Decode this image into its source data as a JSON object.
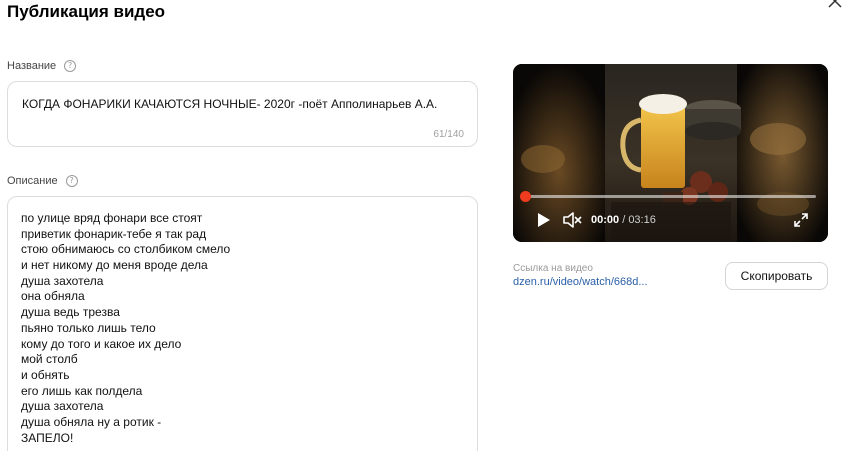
{
  "dialog": {
    "title": "Публикация видео",
    "close_icon": "close-icon"
  },
  "name_field": {
    "label": "Название",
    "help_icon": "question-icon",
    "value": "КОГДА ФОНАРИКИ КАЧАЮТСЯ НОЧНЫЕ- 2020г -поёт Апполинарьев А.А.",
    "counter": "61/140"
  },
  "description_field": {
    "label": "Описание",
    "help_icon": "question-icon",
    "lines": [
      "по улице вряд фонари все стоят",
      "приветик фонарик-тебе я так рад",
      "стою обнимаюсь со столбиком смело",
      "и нет никому до меня вроде дела",
      "душа захотела",
      "она обняла",
      "душа ведь трезва",
      "пьяно только лишь тело",
      "кому до того и какое их дело",
      "мой столб",
      "и обнять",
      "его лишь как полдела",
      "душа захотела",
      "душа обняла  ну а ротик -",
      "ЗАПЕЛО!"
    ]
  },
  "player": {
    "current_time": "00:00",
    "separator": " / ",
    "duration": "03:16",
    "progress": 0,
    "accent_color": "#f03c1e",
    "icons": [
      "play-icon",
      "mute-icon",
      "fullscreen-icon"
    ]
  },
  "share": {
    "label": "Ссылка на видео",
    "url": "dzen.ru/video/watch/668d...",
    "copy_label": "Скопировать"
  }
}
